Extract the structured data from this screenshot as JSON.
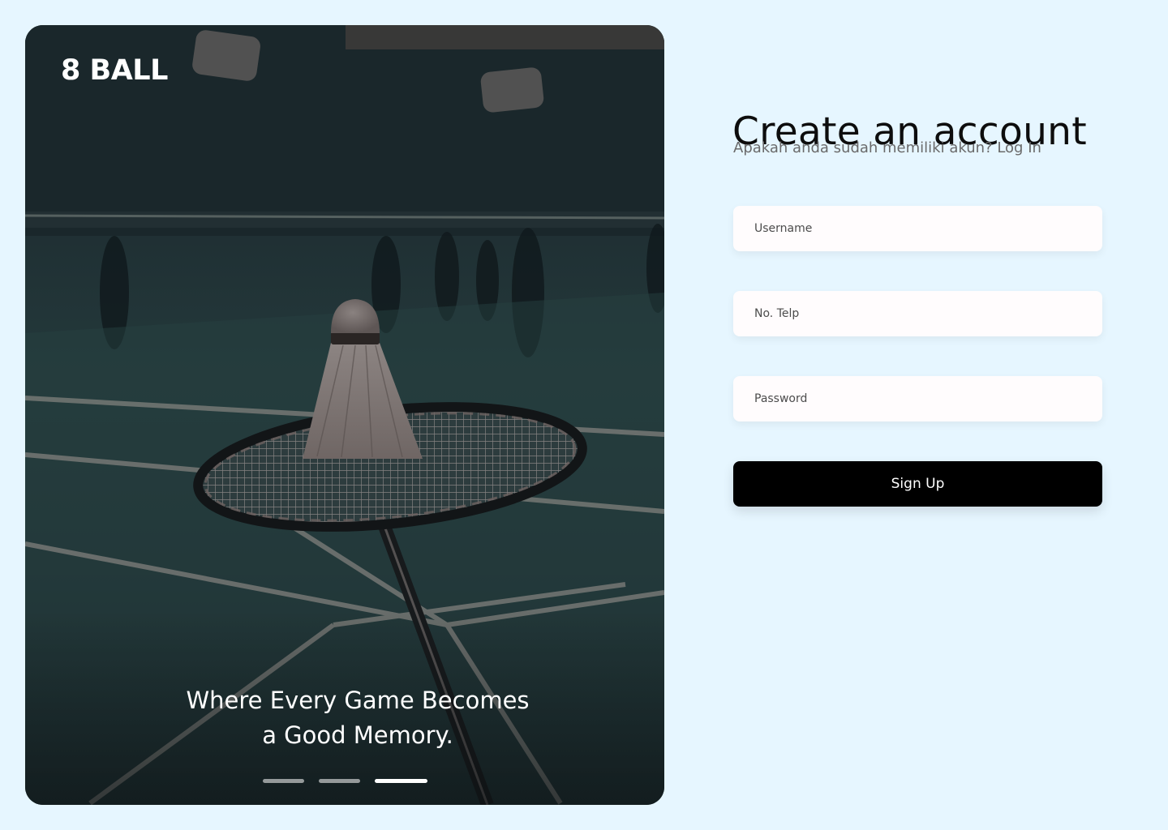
{
  "hero": {
    "brand": "8 BALL",
    "tagline_line1": "Where Every Game Becomes",
    "tagline_line2": "a Good Memory.",
    "carousel": {
      "slides": 3,
      "active": 3
    },
    "photo_icon": "badminton-shuttlecock-on-racket"
  },
  "form": {
    "title": "Create an account",
    "subtitle_text": "Apakah anda sudah memiliki akun?",
    "login_link": "Log In",
    "username_placeholder": "Username",
    "phone_placeholder": "No. Telp",
    "password_placeholder": "Password",
    "submit_label": "Sign Up"
  },
  "colors": {
    "page_background": "#e6f6ff",
    "button_background": "#000000",
    "button_text": "#ffffff"
  }
}
